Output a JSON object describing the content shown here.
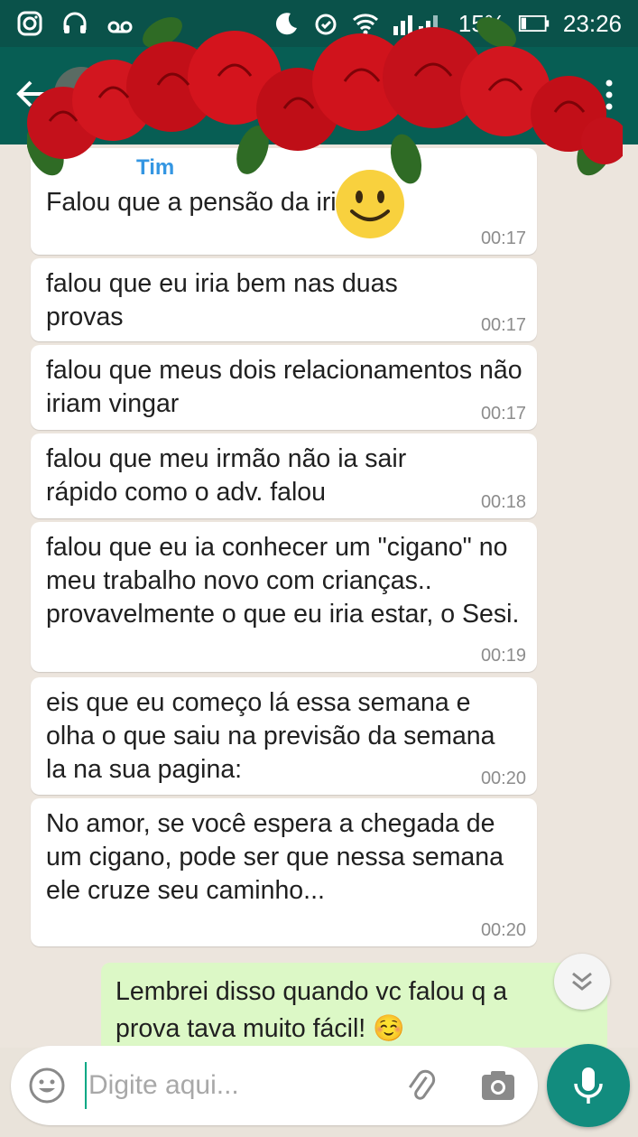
{
  "status_bar": {
    "battery": "15%",
    "time": "23:26",
    "icons": [
      "instagram-icon",
      "headset-icon",
      "voicemail-icon",
      "moon-icon",
      "alarm-icon",
      "wifi-icon",
      "signal-icon",
      "battery-icon"
    ]
  },
  "header": {
    "back_icon": "arrow-left-icon",
    "menu_icon": "more-vert-icon"
  },
  "messages": [
    {
      "sender": "Tim",
      "text": "Falou que a pensão da iria sair",
      "time": "00:17"
    },
    {
      "text": "falou que eu iria bem nas duas provas",
      "time": "00:17"
    },
    {
      "text": "falou que meus dois relacionamentos não iriam vingar",
      "time": "00:17"
    },
    {
      "text": "falou que meu irmão não ia sair rápido como o adv. falou",
      "time": "00:18"
    },
    {
      "text": "falou que eu ia conhecer um \"cigano\" no meu trabalho novo com crianças.. provavelmente o que eu iria estar, o Sesi.",
      "time": "00:19"
    },
    {
      "text": "eis que eu começo lá essa semana e olha o que saiu na previsão da semana la na sua pagina:",
      "time": "00:20"
    },
    {
      "text": "No amor, se você espera a chegada de um cigano, pode ser que nessa semana ele cruze seu caminho...",
      "time": "00:20"
    }
  ],
  "outgoing": {
    "text": "Lembrei disso quando vc falou q a prova tava muito fácil! ☺️"
  },
  "composer": {
    "placeholder": "Digite aqui...",
    "value": ""
  },
  "colors": {
    "header": "#075e54",
    "status_bar": "#0a524a",
    "outgoing_bubble": "#dcf8c6",
    "fab": "#128c7e",
    "sender": "#3496e2"
  }
}
